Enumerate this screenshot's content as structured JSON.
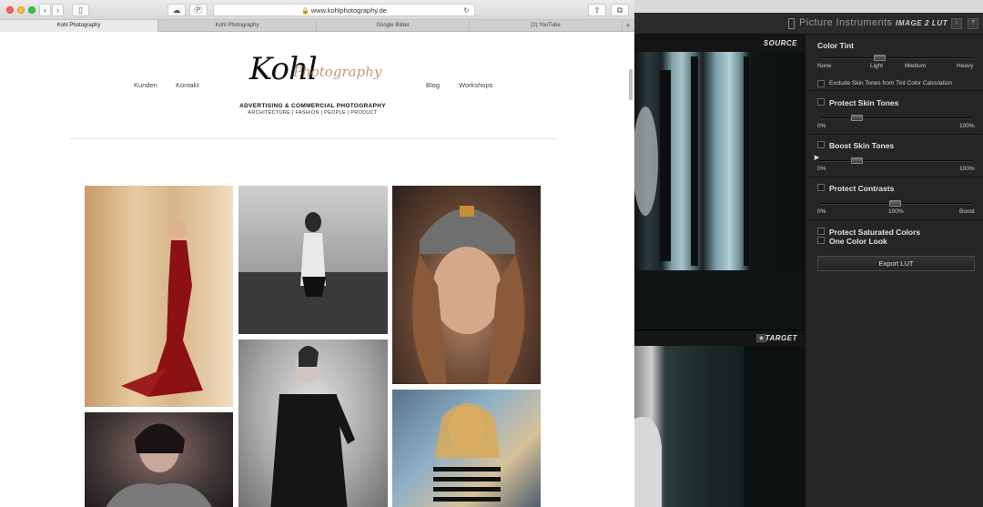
{
  "browser": {
    "url": "www.kohlphotography.de",
    "tabs": [
      {
        "label": "Kohl Photography"
      },
      {
        "label": "Kohl Photography"
      },
      {
        "label": "Google Bilder"
      },
      {
        "label": "(2) YouTube"
      }
    ],
    "new_tab_label": "+"
  },
  "site": {
    "nav_left": [
      "Kunden",
      "Kontakt"
    ],
    "nav_right": [
      "Blog",
      "Workshops"
    ],
    "logo_main": "Kohl",
    "logo_script": "Photography",
    "logo_tagline": "ADVERTISING & COMMERCIAL PHOTOGRAPHY",
    "logo_subline": "ARCHITECTURE | FASHION | PEOPLE | PRODUCT",
    "photos": [
      "photo-1",
      "photo-2",
      "photo-3",
      "photo-4",
      "photo-5",
      "photo-6"
    ]
  },
  "plugin": {
    "brand": "Picture Instruments",
    "separator": "-",
    "product": "IMAGE 2 LUT",
    "info_btn": "i",
    "help_btn": "?",
    "source_label": "SOURCE",
    "target_label": "TARGET",
    "color_tint": {
      "title": "Color Tint",
      "ticks": [
        "None",
        "Light",
        "Medium",
        "Heavy"
      ],
      "value_index": 1,
      "value_fraction": 0.39
    },
    "exclude_skin": {
      "label": "Exclude Skin Tones from Tint Color Calculation",
      "checked": false
    },
    "protect_skin": {
      "title": "Protect Skin Tones",
      "checked": false,
      "min": "0%",
      "max": "100%",
      "value_fraction": 0.24
    },
    "boost_skin": {
      "title": "Boost Skin Tones",
      "checked": false,
      "min": "0%",
      "max": "100%",
      "value_fraction": 0.24
    },
    "protect_contrasts": {
      "title": "Protect Contrasts",
      "checked": false,
      "min": "0%",
      "mid": "100%",
      "max": "Boost",
      "value_fraction": 0.49
    },
    "protect_saturated": {
      "title": "Protect Saturated Colors",
      "checked": false
    },
    "one_color": {
      "title": "One Color Look",
      "checked": false
    },
    "export_label": "Export LUT"
  }
}
